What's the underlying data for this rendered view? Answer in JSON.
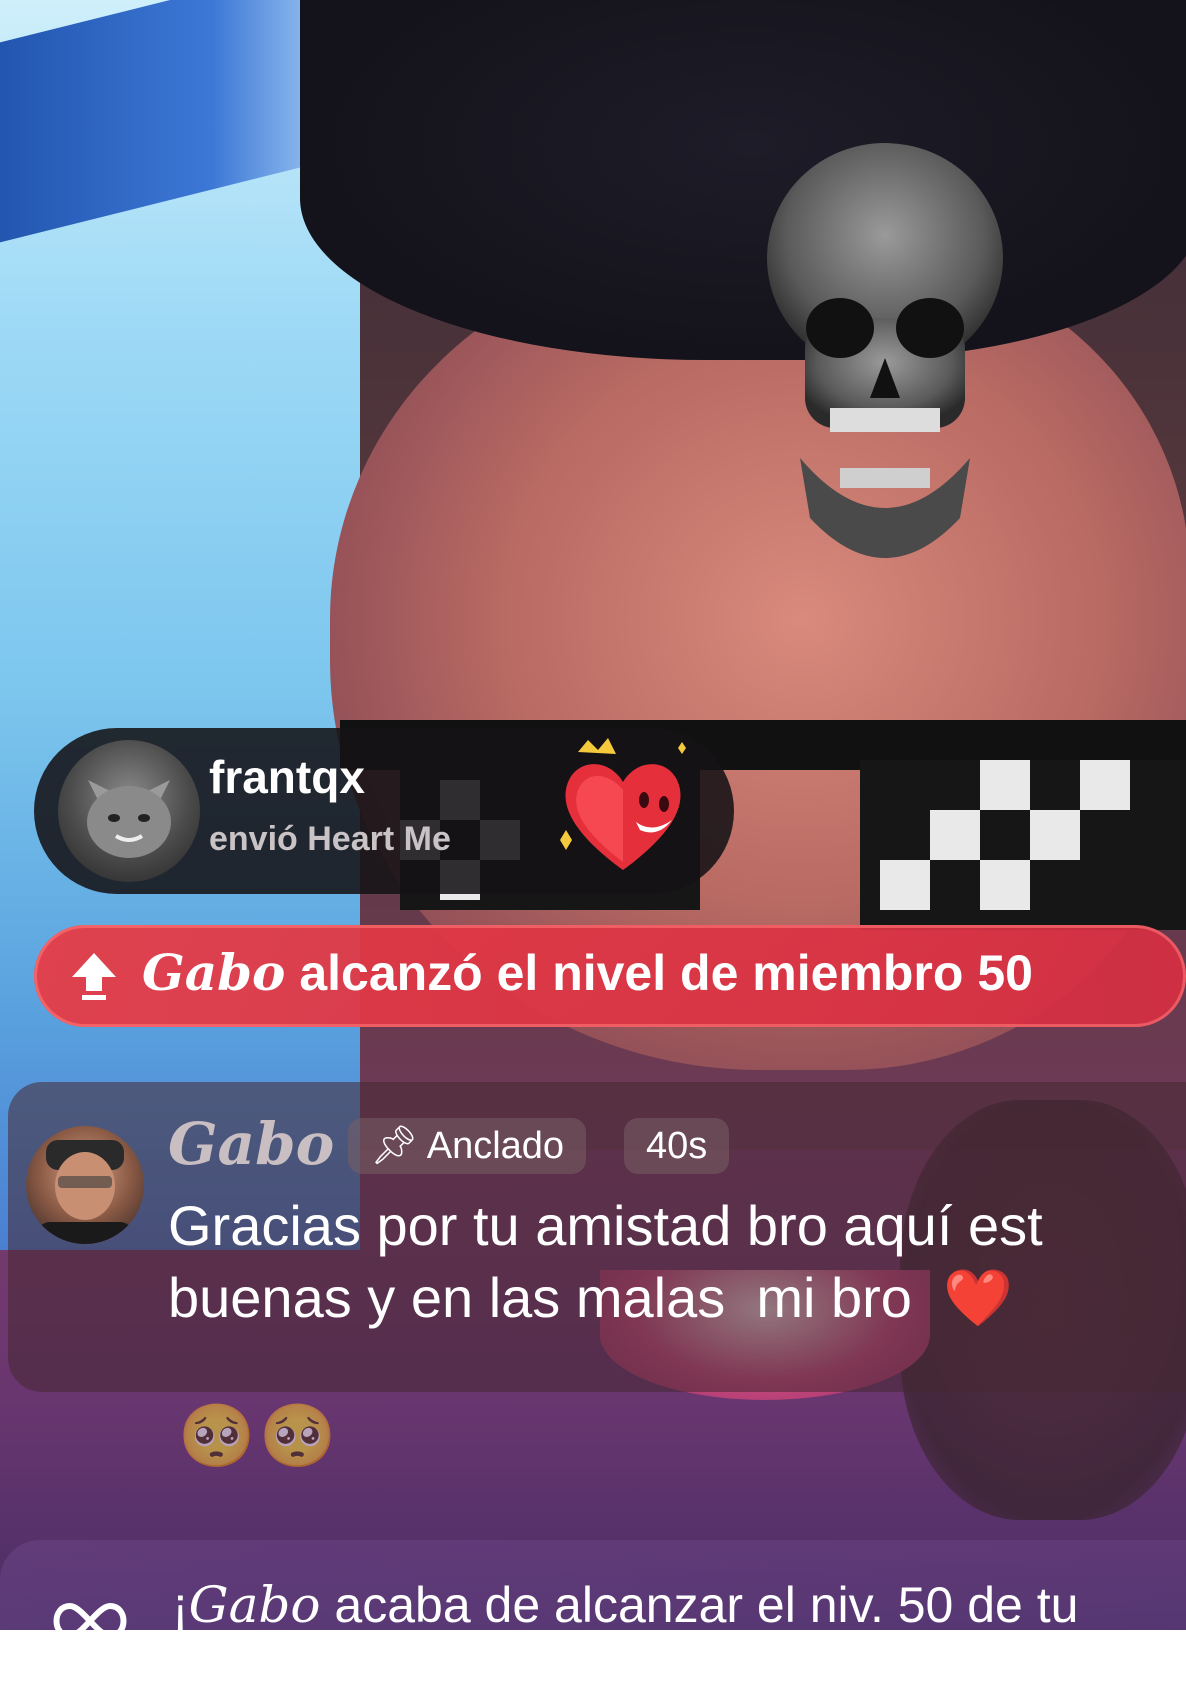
{
  "gift_notification": {
    "username": "frantqx",
    "action": "envió Heart Me",
    "gift_icon": "heart-me-gift-icon"
  },
  "level_banner": {
    "icon": "arrow-up-icon",
    "name": "Gabo",
    "text": " alcanzó el nivel de miembro 50"
  },
  "pinned_message": {
    "username": "Gabo",
    "badge_label": "Anclado",
    "badge_icon": "pin-icon",
    "time": "40s",
    "text_line1": "Gracias por tu amistad bro aquí est",
    "text_line2": "buenas y en las malas  mi bro  ",
    "heart": "❤️"
  },
  "reactions": "🥺🥺",
  "system_message": {
    "icon": "infinity-icon",
    "prefix": "¡",
    "name": "Gabo",
    "text": " acaba de alcanzar el niv. 50 de tu"
  },
  "colors": {
    "level_banner": "#e03a48",
    "gift_pill": "#141216",
    "heart": "#e8242f"
  }
}
